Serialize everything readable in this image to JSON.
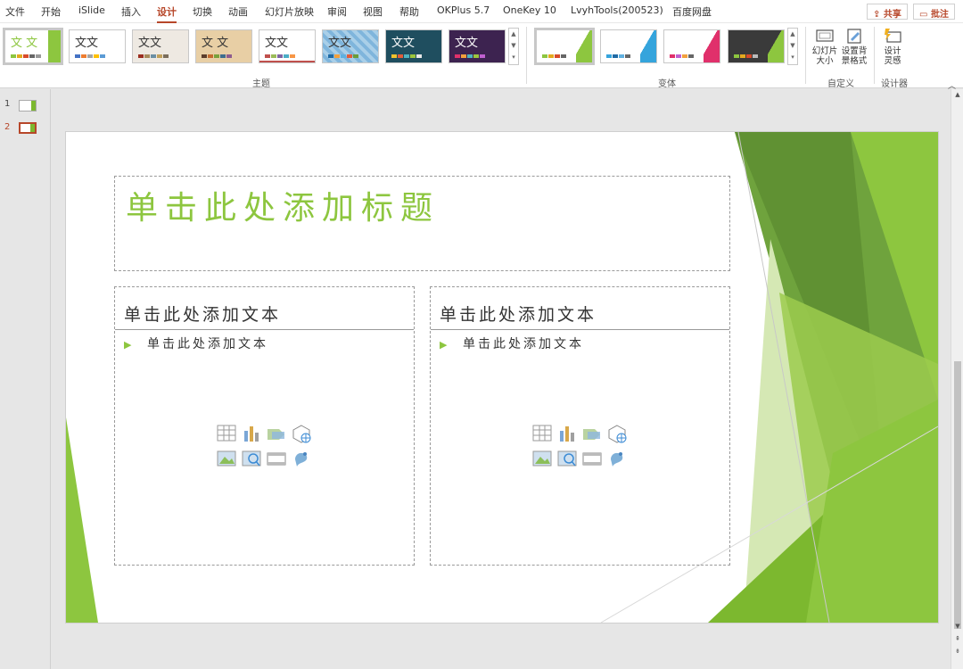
{
  "menu": {
    "items": [
      {
        "label": "文件"
      },
      {
        "label": "开始"
      },
      {
        "label": "iSlide"
      },
      {
        "label": "插入"
      },
      {
        "label": "设计"
      },
      {
        "label": "切换"
      },
      {
        "label": "动画"
      },
      {
        "label": "幻灯片放映"
      },
      {
        "label": "审阅"
      },
      {
        "label": "视图"
      },
      {
        "label": "帮助"
      },
      {
        "label": "OKPlus 5.7"
      },
      {
        "label": "OneKey 10"
      },
      {
        "label": "LvyhTools(200523)"
      },
      {
        "label": "百度网盘"
      }
    ],
    "active": "设计",
    "share_label": "共享",
    "comment_label": "批注"
  },
  "ribbon": {
    "themes_label": "主题",
    "variants_label": "变体",
    "custom_label": "自定义",
    "designer_label": "设计器",
    "theme_thumb_text": "文文",
    "theme_thumb_text_b": "文 文",
    "slide_size_label": "幻灯片大小",
    "format_bg_label": "设置背景格式",
    "design_ideas_label": "设计灵感"
  },
  "slides": [
    {
      "number": "1"
    },
    {
      "number": "2"
    }
  ],
  "slide": {
    "title_placeholder": "单击此处添加标题",
    "left_heading": "单击此处添加文本",
    "left_bullet": "单击此处添加文本",
    "right_heading": "单击此处添加文本",
    "right_bullet": "单击此处添加文本"
  },
  "colors": {
    "accent": "#b7472a",
    "theme_green": "#8dc63f"
  }
}
